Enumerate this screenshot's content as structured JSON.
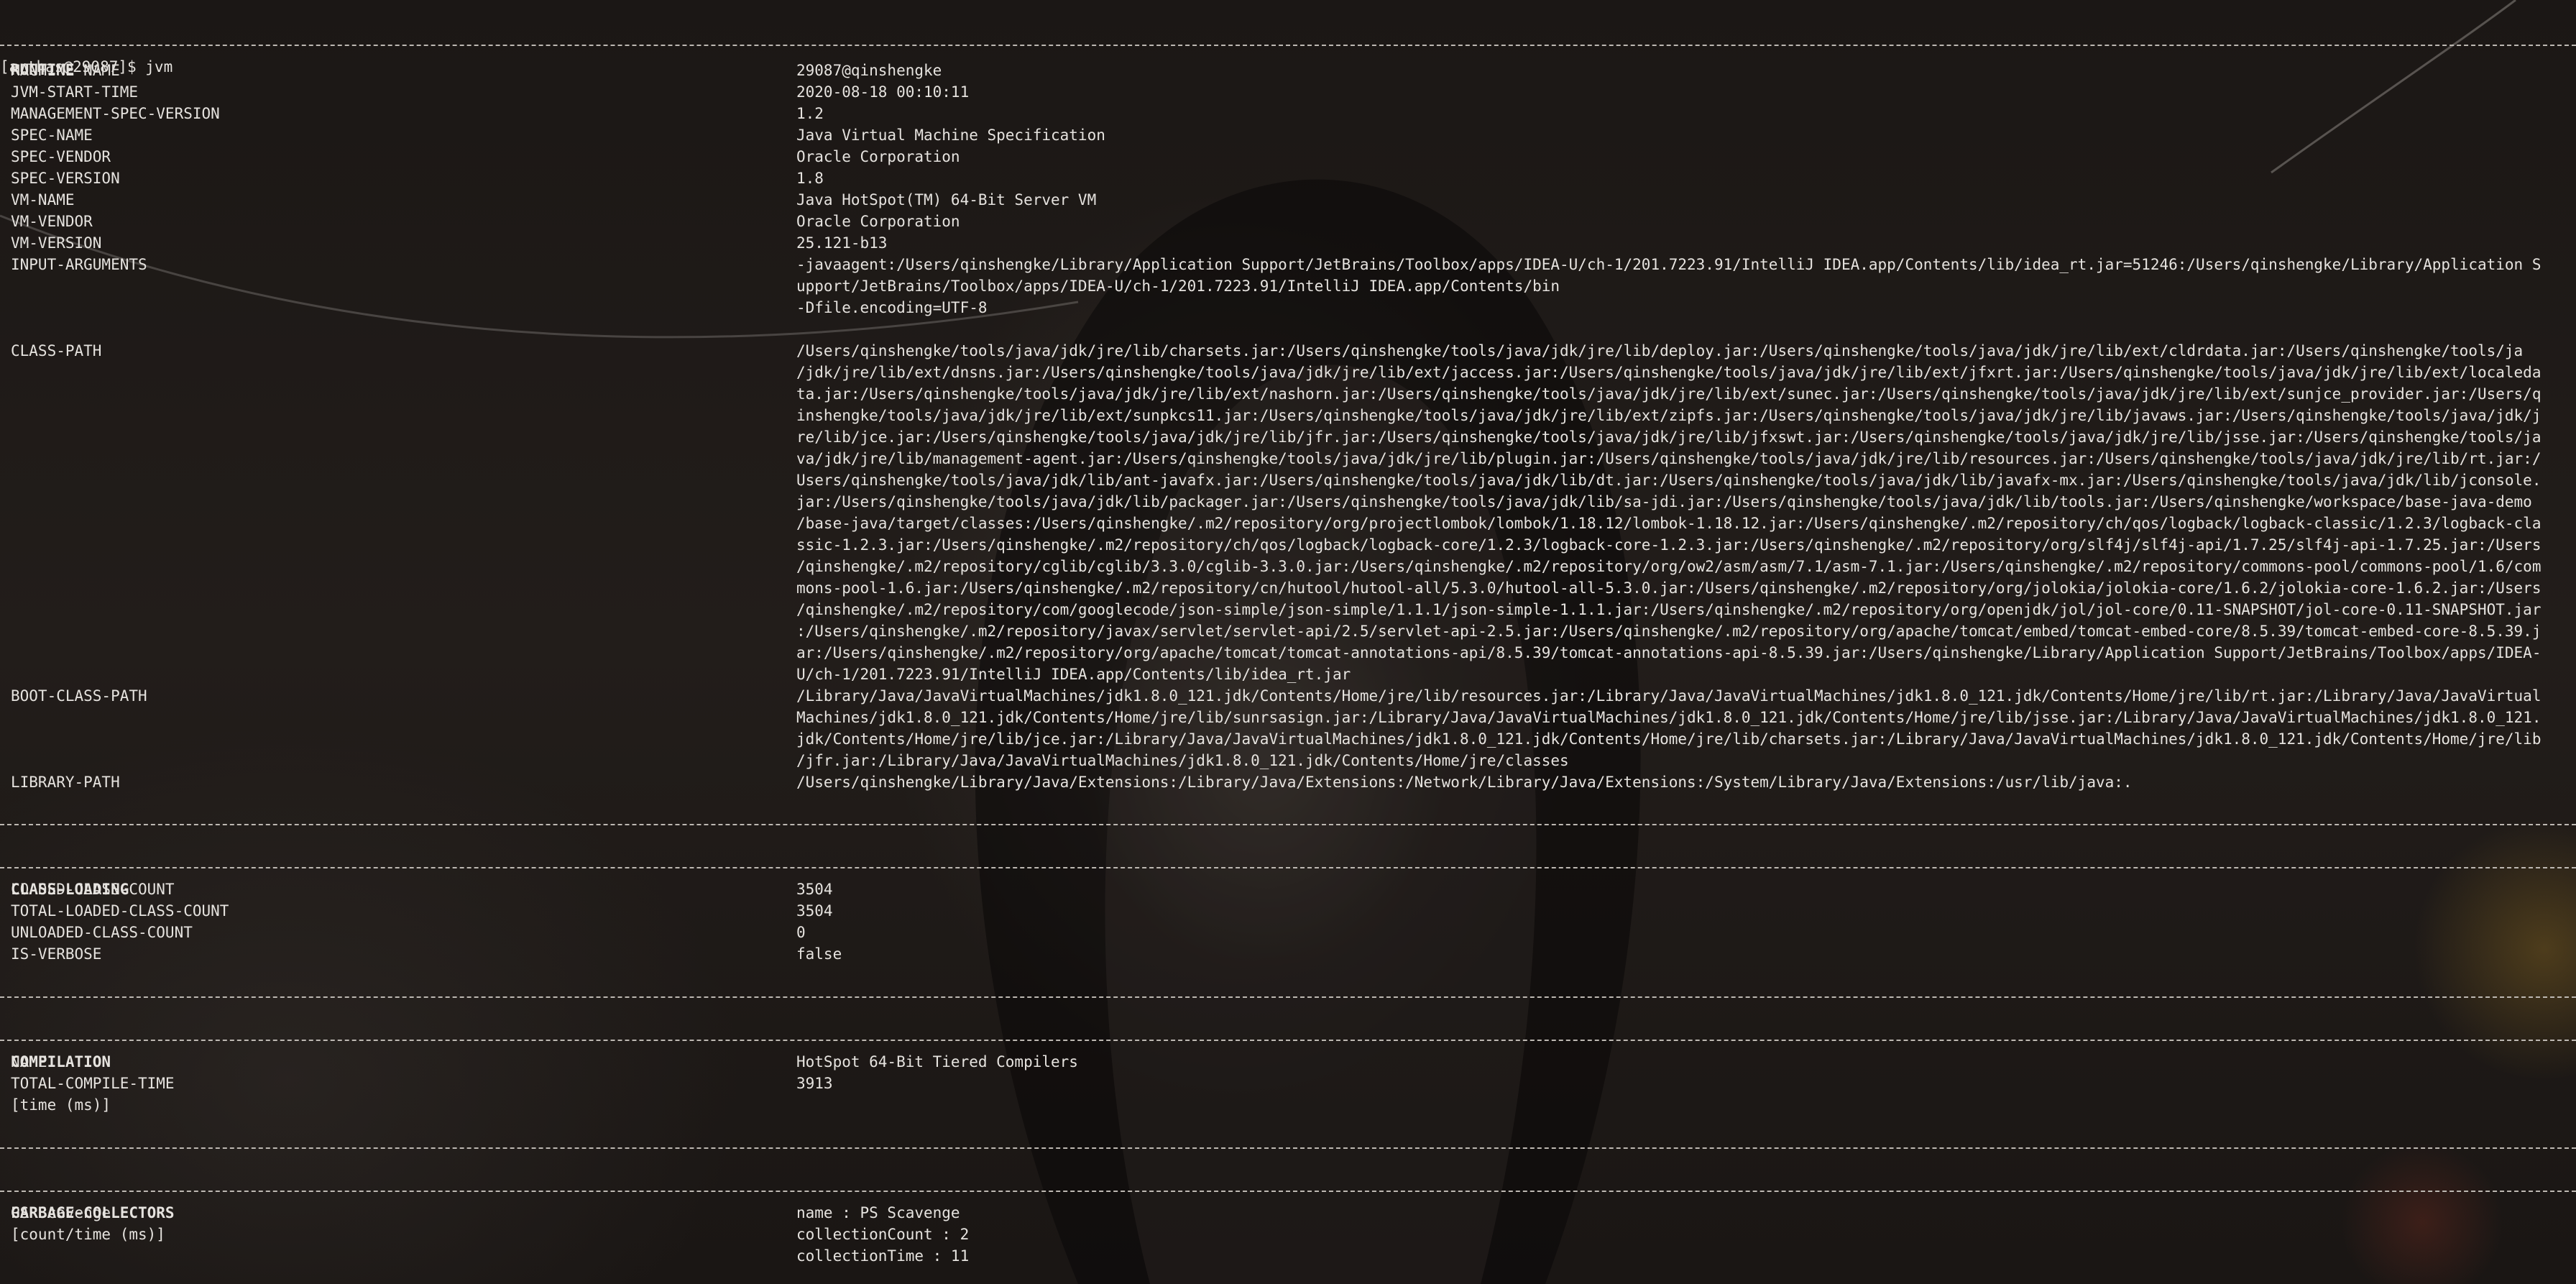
{
  "prompt": "[arthas@29087]$ jvm",
  "runtime": {
    "title": "RUNTIME",
    "rows": [
      {
        "key": "MACHINE-NAME",
        "val": "29087@qinshengke"
      },
      {
        "key": "JVM-START-TIME",
        "val": "2020-08-18 00:10:11"
      },
      {
        "key": "MANAGEMENT-SPEC-VERSION",
        "val": "1.2"
      },
      {
        "key": "SPEC-NAME",
        "val": "Java Virtual Machine Specification"
      },
      {
        "key": "SPEC-VENDOR",
        "val": "Oracle Corporation"
      },
      {
        "key": "SPEC-VERSION",
        "val": "1.8"
      },
      {
        "key": "VM-NAME",
        "val": "Java HotSpot(TM) 64-Bit Server VM"
      },
      {
        "key": "VM-VENDOR",
        "val": "Oracle Corporation"
      },
      {
        "key": "VM-VERSION",
        "val": "25.121-b13"
      }
    ],
    "input_arguments_key": "INPUT-ARGUMENTS",
    "input_arguments": [
      "-javaagent:/Users/qinshengke/Library/Application Support/JetBrains/Toolbox/apps/IDEA-U/ch-1/201.7223.91/IntelliJ IDEA.app/Contents/lib/idea_rt.jar=51246:/Users/qinshengke/Library/Application S",
      "upport/JetBrains/Toolbox/apps/IDEA-U/ch-1/201.7223.91/IntelliJ IDEA.app/Contents/bin",
      "-Dfile.encoding=UTF-8"
    ],
    "class_path_key": "CLASS-PATH",
    "class_path": [
      "/Users/qinshengke/tools/java/jdk/jre/lib/charsets.jar:/Users/qinshengke/tools/java/jdk/jre/lib/deploy.jar:/Users/qinshengke/tools/java/jdk/jre/lib/ext/cldrdata.jar:/Users/qinshengke/tools/ja",
      "/jdk/jre/lib/ext/dnsns.jar:/Users/qinshengke/tools/java/jdk/jre/lib/ext/jaccess.jar:/Users/qinshengke/tools/java/jdk/jre/lib/ext/jfxrt.jar:/Users/qinshengke/tools/java/jdk/jre/lib/ext/localeda",
      "ta.jar:/Users/qinshengke/tools/java/jdk/jre/lib/ext/nashorn.jar:/Users/qinshengke/tools/java/jdk/jre/lib/ext/sunec.jar:/Users/qinshengke/tools/java/jdk/jre/lib/ext/sunjce_provider.jar:/Users/q",
      "inshengke/tools/java/jdk/jre/lib/ext/sunpkcs11.jar:/Users/qinshengke/tools/java/jdk/jre/lib/ext/zipfs.jar:/Users/qinshengke/tools/java/jdk/jre/lib/javaws.jar:/Users/qinshengke/tools/java/jdk/j",
      "re/lib/jce.jar:/Users/qinshengke/tools/java/jdk/jre/lib/jfr.jar:/Users/qinshengke/tools/java/jdk/jre/lib/jfxswt.jar:/Users/qinshengke/tools/java/jdk/jre/lib/jsse.jar:/Users/qinshengke/tools/ja",
      "va/jdk/jre/lib/management-agent.jar:/Users/qinshengke/tools/java/jdk/jre/lib/plugin.jar:/Users/qinshengke/tools/java/jdk/jre/lib/resources.jar:/Users/qinshengke/tools/java/jdk/jre/lib/rt.jar:/",
      "Users/qinshengke/tools/java/jdk/lib/ant-javafx.jar:/Users/qinshengke/tools/java/jdk/lib/dt.jar:/Users/qinshengke/tools/java/jdk/lib/javafx-mx.jar:/Users/qinshengke/tools/java/jdk/lib/jconsole.",
      "jar:/Users/qinshengke/tools/java/jdk/lib/packager.jar:/Users/qinshengke/tools/java/jdk/lib/sa-jdi.jar:/Users/qinshengke/tools/java/jdk/lib/tools.jar:/Users/qinshengke/workspace/base-java-demo",
      "/base-java/target/classes:/Users/qinshengke/.m2/repository/org/projectlombok/lombok/1.18.12/lombok-1.18.12.jar:/Users/qinshengke/.m2/repository/ch/qos/logback/logback-classic/1.2.3/logback-cla",
      "ssic-1.2.3.jar:/Users/qinshengke/.m2/repository/ch/qos/logback/logback-core/1.2.3/logback-core-1.2.3.jar:/Users/qinshengke/.m2/repository/org/slf4j/slf4j-api/1.7.25/slf4j-api-1.7.25.jar:/Users",
      "/qinshengke/.m2/repository/cglib/cglib/3.3.0/cglib-3.3.0.jar:/Users/qinshengke/.m2/repository/org/ow2/asm/asm/7.1/asm-7.1.jar:/Users/qinshengke/.m2/repository/commons-pool/commons-pool/1.6/com",
      "mons-pool-1.6.jar:/Users/qinshengke/.m2/repository/cn/hutool/hutool-all/5.3.0/hutool-all-5.3.0.jar:/Users/qinshengke/.m2/repository/org/jolokia/jolokia-core/1.6.2/jolokia-core-1.6.2.jar:/Users",
      "/qinshengke/.m2/repository/com/googlecode/json-simple/json-simple/1.1.1/json-simple-1.1.1.jar:/Users/qinshengke/.m2/repository/org/openjdk/jol/jol-core/0.11-SNAPSHOT/jol-core-0.11-SNAPSHOT.jar",
      ":/Users/qinshengke/.m2/repository/javax/servlet/servlet-api/2.5/servlet-api-2.5.jar:/Users/qinshengke/.m2/repository/org/apache/tomcat/embed/tomcat-embed-core/8.5.39/tomcat-embed-core-8.5.39.j",
      "ar:/Users/qinshengke/.m2/repository/org/apache/tomcat/tomcat-annotations-api/8.5.39/tomcat-annotations-api-8.5.39.jar:/Users/qinshengke/Library/Application Support/JetBrains/Toolbox/apps/IDEA-",
      "U/ch-1/201.7223.91/IntelliJ IDEA.app/Contents/lib/idea_rt.jar"
    ],
    "boot_class_path_key": "BOOT-CLASS-PATH",
    "boot_class_path": [
      "/Library/Java/JavaVirtualMachines/jdk1.8.0_121.jdk/Contents/Home/jre/lib/resources.jar:/Library/Java/JavaVirtualMachines/jdk1.8.0_121.jdk/Contents/Home/jre/lib/rt.jar:/Library/Java/JavaVirtual",
      "Machines/jdk1.8.0_121.jdk/Contents/Home/jre/lib/sunrsasign.jar:/Library/Java/JavaVirtualMachines/jdk1.8.0_121.jdk/Contents/Home/jre/lib/jsse.jar:/Library/Java/JavaVirtualMachines/jdk1.8.0_121.",
      "jdk/Contents/Home/jre/lib/jce.jar:/Library/Java/JavaVirtualMachines/jdk1.8.0_121.jdk/Contents/Home/jre/lib/charsets.jar:/Library/Java/JavaVirtualMachines/jdk1.8.0_121.jdk/Contents/Home/jre/lib",
      "/jfr.jar:/Library/Java/JavaVirtualMachines/jdk1.8.0_121.jdk/Contents/Home/jre/classes"
    ],
    "library_path_key": "LIBRARY-PATH",
    "library_path": "/Users/qinshengke/Library/Java/Extensions:/Library/Java/Extensions:/Network/Library/Java/Extensions:/System/Library/Java/Extensions:/usr/lib/java:."
  },
  "class_loading": {
    "title": "CLASS-LOADING",
    "rows": [
      {
        "key": "LOADED-CLASS-COUNT",
        "val": "3504"
      },
      {
        "key": "TOTAL-LOADED-CLASS-COUNT",
        "val": "3504"
      },
      {
        "key": "UNLOADED-CLASS-COUNT",
        "val": "0"
      },
      {
        "key": "IS-VERBOSE",
        "val": "false"
      }
    ]
  },
  "compilation": {
    "title": "COMPILATION",
    "rows": [
      {
        "key": "NAME",
        "val": "HotSpot 64-Bit Tiered Compilers"
      },
      {
        "key": "TOTAL-COMPILE-TIME",
        "val": "3913"
      },
      {
        "key": "[time (ms)]",
        "val": ""
      }
    ]
  },
  "garbage_collectors": {
    "title": "GARBAGE-COLLECTORS",
    "rows": [
      {
        "key": "PS Scavenge",
        "val": "name : PS Scavenge"
      },
      {
        "key": "[count/time (ms)]",
        "val": "collectionCount : 2"
      },
      {
        "key": "",
        "val": "collectionTime : 11"
      }
    ]
  }
}
